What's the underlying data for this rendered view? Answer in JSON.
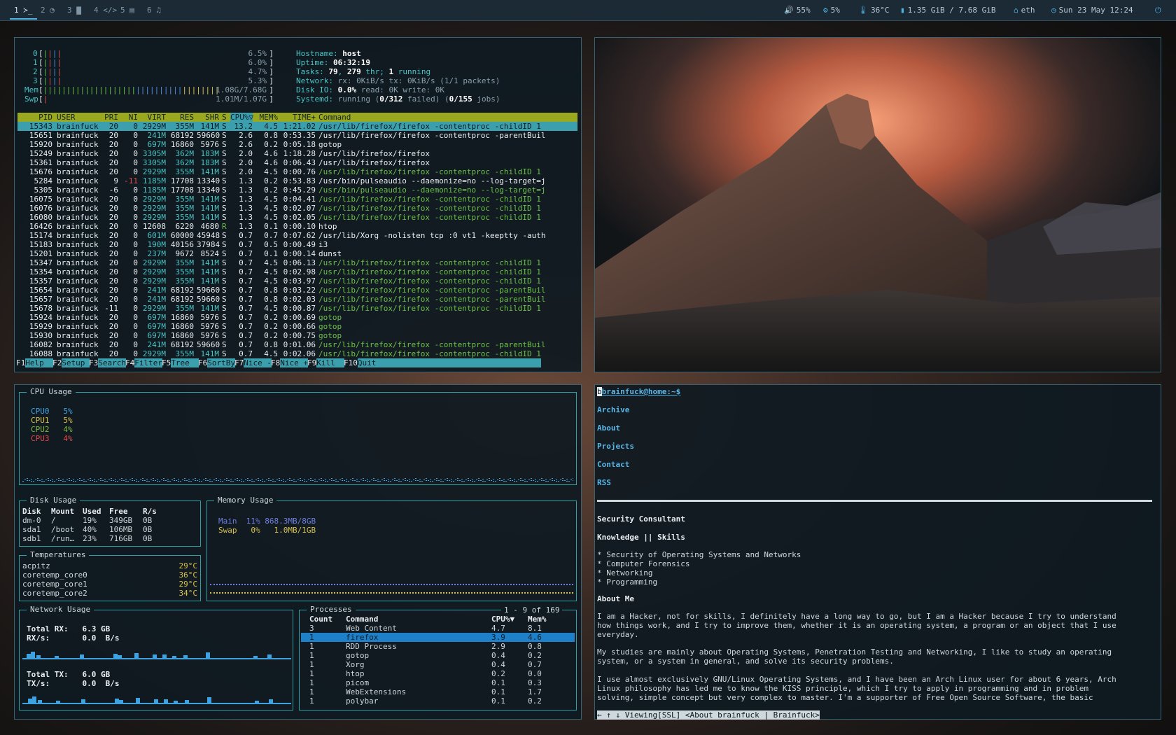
{
  "topbar": {
    "workspaces": [
      {
        "label": "1 ≻_",
        "active": true
      },
      {
        "label": "2 ◔",
        "active": false
      },
      {
        "label": "3 ▇",
        "active": false
      },
      {
        "label": "4 </>",
        "active": false
      },
      {
        "label": "5 ▤",
        "active": false
      },
      {
        "label": "6 ♫",
        "active": false
      }
    ],
    "volume": "55%",
    "cpu": "5%",
    "temp": "36°C",
    "memory": "1.35 GiB / 7.68 GiB",
    "network": "eth",
    "datetime": "Sun 23 May 12:24",
    "icons": {
      "volume": "volume-icon",
      "cpu": "cpu-icon",
      "temp": "thermometer-icon",
      "memory": "memory-icon",
      "network": "network-icon",
      "clock": "clock-icon",
      "power": "power-icon"
    }
  },
  "htop": {
    "cpus": [
      {
        "id": "0",
        "pct": "6.5%"
      },
      {
        "id": "1",
        "pct": "6.0%"
      },
      {
        "id": "2",
        "pct": "4.7%"
      },
      {
        "id": "3",
        "pct": "5.3%"
      }
    ],
    "mem_label": "Mem",
    "mem_value": "1.08G/7.68G",
    "swp_label": "Swp",
    "swp_value": "1.01M/1.07G",
    "info": {
      "hostname_label": "Hostname:",
      "hostname": "host",
      "uptime_label": "Uptime:",
      "uptime": "06:32:19",
      "tasks_label": "Tasks:",
      "tasks": "79",
      "thr": "279",
      "thr_label": "thr;",
      "running": "1",
      "running_label": "running",
      "network_label": "Network:",
      "network": "rx: 0KiB/s tx: 0KiB/s (1/1 packets)",
      "disk_label": "Disk IO:",
      "disk_pct": "0.0%",
      "disk_rest": "read: 0K write: 0K",
      "systemd_label": "Systemd:",
      "systemd_state": "running",
      "systemd_failed": "0/312",
      "systemd_failed_label": "failed)",
      "systemd_jobs": "0/155",
      "systemd_jobs_label": "jobs)"
    },
    "header": [
      "PID",
      "USER",
      "PRI",
      "NI",
      "VIRT",
      "RES",
      "SHR",
      "S",
      "CPU%▽",
      "MEM%",
      "TIME+",
      "Command"
    ],
    "rows": [
      [
        "15343",
        "brainfuck",
        "20",
        "0",
        "2929M",
        "355M",
        "141M",
        "S",
        "13.2",
        "4.5",
        "1:21.02",
        "/usr/lib/firefox/firefox -contentproc -childID 1"
      ],
      [
        "15651",
        "brainfuck",
        "20",
        "0",
        "241M",
        "68192",
        "59660",
        "S",
        "2.6",
        "0.8",
        "0:53.35",
        "/usr/lib/firefox/firefox -contentproc -parentBuil"
      ],
      [
        "15920",
        "brainfuck",
        "20",
        "0",
        "697M",
        "16860",
        "5976",
        "S",
        "2.6",
        "0.2",
        "0:05.18",
        "gotop"
      ],
      [
        "15249",
        "brainfuck",
        "20",
        "0",
        "3305M",
        "362M",
        "183M",
        "S",
        "2.0",
        "4.6",
        "1:18.28",
        "/usr/lib/firefox/firefox"
      ],
      [
        "15361",
        "brainfuck",
        "20",
        "0",
        "3305M",
        "362M",
        "183M",
        "S",
        "2.0",
        "4.6",
        "0:06.43",
        "/usr/lib/firefox/firefox"
      ],
      [
        "15676",
        "brainfuck",
        "20",
        "0",
        "2929M",
        "355M",
        "141M",
        "S",
        "2.0",
        "4.5",
        "0:00.76",
        "/usr/lib/firefox/firefox -contentproc -childID 1"
      ],
      [
        "5284",
        "brainfuck",
        "9",
        "-11",
        "1185M",
        "17708",
        "13340",
        "S",
        "1.3",
        "0.2",
        "0:53.83",
        "/usr/bin/pulseaudio --daemonize=no --log-target=j"
      ],
      [
        "5305",
        "brainfuck",
        "-6",
        "0",
        "1185M",
        "17708",
        "13340",
        "S",
        "1.3",
        "0.2",
        "0:45.29",
        "/usr/bin/pulseaudio --daemonize=no --log-target=j"
      ],
      [
        "16075",
        "brainfuck",
        "20",
        "0",
        "2929M",
        "355M",
        "141M",
        "S",
        "1.3",
        "4.5",
        "0:04.41",
        "/usr/lib/firefox/firefox -contentproc -childID 1"
      ],
      [
        "16076",
        "brainfuck",
        "20",
        "0",
        "2929M",
        "355M",
        "141M",
        "S",
        "1.3",
        "4.5",
        "0:02.07",
        "/usr/lib/firefox/firefox -contentproc -childID 1"
      ],
      [
        "16080",
        "brainfuck",
        "20",
        "0",
        "2929M",
        "355M",
        "141M",
        "S",
        "1.3",
        "4.5",
        "0:02.05",
        "/usr/lib/firefox/firefox -contentproc -childID 1"
      ],
      [
        "16426",
        "brainfuck",
        "20",
        "0",
        "12608",
        "6220",
        "4680",
        "R",
        "1.3",
        "0.1",
        "0:00.10",
        "htop"
      ],
      [
        "15174",
        "brainfuck",
        "20",
        "0",
        "601M",
        "60000",
        "45948",
        "S",
        "0.7",
        "0.7",
        "0:07.62",
        "/usr/lib/Xorg -nolisten tcp :0 vt1 -keeptty -auth"
      ],
      [
        "15183",
        "brainfuck",
        "20",
        "0",
        "190M",
        "40156",
        "37984",
        "S",
        "0.7",
        "0.5",
        "0:00.49",
        "i3"
      ],
      [
        "15201",
        "brainfuck",
        "20",
        "0",
        "237M",
        "9672",
        "8524",
        "S",
        "0.7",
        "0.1",
        "0:00.14",
        "dunst"
      ],
      [
        "15347",
        "brainfuck",
        "20",
        "0",
        "2929M",
        "355M",
        "141M",
        "S",
        "0.7",
        "4.5",
        "0:06.13",
        "/usr/lib/firefox/firefox -contentproc -childID 1"
      ],
      [
        "15354",
        "brainfuck",
        "20",
        "0",
        "2929M",
        "355M",
        "141M",
        "S",
        "0.7",
        "4.5",
        "0:02.98",
        "/usr/lib/firefox/firefox -contentproc -childID 1"
      ],
      [
        "15357",
        "brainfuck",
        "20",
        "0",
        "2929M",
        "355M",
        "141M",
        "S",
        "0.7",
        "4.5",
        "0:03.97",
        "/usr/lib/firefox/firefox -contentproc -childID 1"
      ],
      [
        "15654",
        "brainfuck",
        "20",
        "0",
        "241M",
        "68192",
        "59660",
        "S",
        "0.7",
        "0.8",
        "0:03.22",
        "/usr/lib/firefox/firefox -contentproc -parentBuil"
      ],
      [
        "15657",
        "brainfuck",
        "20",
        "0",
        "241M",
        "68192",
        "59660",
        "S",
        "0.7",
        "0.8",
        "0:02.03",
        "/usr/lib/firefox/firefox -contentproc -parentBuil"
      ],
      [
        "15678",
        "brainfuck",
        "-11",
        "0",
        "2929M",
        "355M",
        "141M",
        "S",
        "0.7",
        "4.5",
        "0:00.87",
        "/usr/lib/firefox/firefox -contentproc -childID 1"
      ],
      [
        "15924",
        "brainfuck",
        "20",
        "0",
        "697M",
        "16860",
        "5976",
        "S",
        "0.7",
        "0.2",
        "0:00.69",
        "gotop"
      ],
      [
        "15929",
        "brainfuck",
        "20",
        "0",
        "697M",
        "16860",
        "5976",
        "S",
        "0.7",
        "0.2",
        "0:00.66",
        "gotop"
      ],
      [
        "15930",
        "brainfuck",
        "20",
        "0",
        "697M",
        "16860",
        "5976",
        "S",
        "0.7",
        "0.2",
        "0:00.75",
        "gotop"
      ],
      [
        "16082",
        "brainfuck",
        "20",
        "0",
        "241M",
        "68192",
        "59660",
        "S",
        "0.7",
        "0.8",
        "0:01.06",
        "/usr/lib/firefox/firefox -contentproc -parentBuil"
      ],
      [
        "16088",
        "brainfuck",
        "20",
        "0",
        "2929M",
        "355M",
        "141M",
        "S",
        "0.7",
        "4.5",
        "0:02.06",
        "/usr/lib/firefox/firefox -contentproc -childID 1"
      ]
    ],
    "fkeys": [
      {
        "k": "F1",
        "l": "Help  "
      },
      {
        "k": "F2",
        "l": "Setup "
      },
      {
        "k": "F3",
        "l": "Search"
      },
      {
        "k": "F4",
        "l": "Filter"
      },
      {
        "k": "F5",
        "l": "Tree  "
      },
      {
        "k": "F6",
        "l": "SortBy"
      },
      {
        "k": "F7",
        "l": "Nice -"
      },
      {
        "k": "F8",
        "l": "Nice +"
      },
      {
        "k": "F9",
        "l": "Kill  "
      },
      {
        "k": "F10",
        "l": "Quit"
      }
    ]
  },
  "gotop": {
    "cpu_title": "CPU Usage",
    "cpus": [
      {
        "name": "CPU0",
        "val": "5%",
        "color": "#3ea2e0"
      },
      {
        "name": "CPU1",
        "val": "5%",
        "color": "#d8c04a"
      },
      {
        "name": "CPU2",
        "val": "4%",
        "color": "#7fb83a"
      },
      {
        "name": "CPU3",
        "val": "4%",
        "color": "#e04848"
      }
    ],
    "disk_title": "Disk Usage",
    "disk_header": [
      "Disk",
      "Mount",
      "Used",
      "Free",
      "R/s"
    ],
    "disks": [
      [
        "dm-0",
        "/",
        "19%",
        "349GB",
        "0B"
      ],
      [
        "sda1",
        "/boot",
        "40%",
        "106MB",
        "0B"
      ],
      [
        "sdb1",
        "/run…",
        "23%",
        "716GB",
        "0B"
      ]
    ],
    "mem_title": "Memory Usage",
    "mem_main_label": "Main",
    "mem_main_pct": "11%",
    "mem_main_val": "868.3MB/8GB",
    "mem_swap_label": "Swap",
    "mem_swap_pct": "0%",
    "mem_swap_val": "1.0MB/1GB",
    "temp_title": "Temperatures",
    "temps": [
      [
        "acpitz",
        "29°C"
      ],
      [
        "coretemp_core0",
        "36°C"
      ],
      [
        "coretemp_core1",
        "29°C"
      ],
      [
        "coretemp_core2",
        "34°C"
      ]
    ],
    "net_title": "Network Usage",
    "rx_total_label": "Total RX:",
    "rx_total": "6.3 GB",
    "rx_rate_label": "RX/s:",
    "rx_rate": "0.0  B/s",
    "tx_total_label": "Total TX:",
    "tx_total": "6.0 GB",
    "tx_rate_label": "TX/s:",
    "tx_rate": "0.0  B/s",
    "proc_title": "Processes",
    "proc_range": "1 - 9 of 169",
    "proc_header": [
      "Count",
      "Command",
      "CPU%▼",
      "Mem%"
    ],
    "procs": [
      [
        "3",
        "Web Content",
        "4.7",
        "8.1"
      ],
      [
        "1",
        "firefox",
        "3.9",
        "4.6"
      ],
      [
        "1",
        "RDD Process",
        "2.9",
        "0.8"
      ],
      [
        "1",
        "gotop",
        "0.4",
        "0.2"
      ],
      [
        "1",
        "Xorg",
        "0.4",
        "0.7"
      ],
      [
        "1",
        "htop",
        "0.2",
        "0.0"
      ],
      [
        "1",
        "picom",
        "0.1",
        "0.3"
      ],
      [
        "1",
        "WebExtensions",
        "0.1",
        "1.7"
      ],
      [
        "1",
        "polybar",
        "0.1",
        "0.2"
      ]
    ]
  },
  "browser": {
    "prompt": "brainfuck@home:~$",
    "links": [
      "Archive",
      "About",
      "Projects",
      "Contact",
      "RSS"
    ],
    "heading1": "Security Consultant",
    "heading2": "Knowledge || Skills",
    "skills": [
      "* Security of Operating Systems and Networks",
      "* Computer Forensics",
      "* Networking",
      "* Programming"
    ],
    "heading3": "About Me",
    "para1": [
      "I am a Hacker, not for skills, I definitely have a long way to go, but I am a Hacker because I try to understand",
      "how things work, and I try to improve them, whether it is an operating system, a program or an object that I use",
      "everyday."
    ],
    "para2": [
      "My studies are mainly about Operating Systems, Penetration Testing and Networking, I like to study an operating",
      "system, or a system in general, and solve its security problems."
    ],
    "para3": [
      "I use almost exclusively GNU/Linux Operating Systems, and I have been an Arch Linux user for about 6 years, Arch",
      "Linux philosophy has led me to know the KISS principle, which I try to apply in programming and in problem",
      "solving, simple concept but very complex to master. I'm a supporter of Free Open Source Software, the basic"
    ],
    "status": "← ↑ ↓ Viewing[SSL] <About brainfuck | Brainfuck>"
  }
}
